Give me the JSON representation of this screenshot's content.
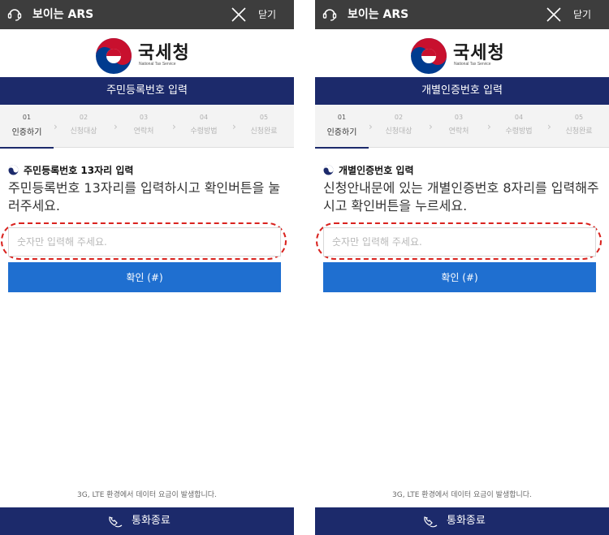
{
  "panels": [
    {
      "topbar": {
        "title": "보이는 ARS",
        "close_label": "닫기"
      },
      "logo": {
        "name": "국세청",
        "subtitle": "National Tax Service"
      },
      "page_title": "주민등록번호 입력",
      "steps": [
        {
          "num": "01",
          "label": "인증하기"
        },
        {
          "num": "02",
          "label": "신청대상"
        },
        {
          "num": "03",
          "label": "연락처"
        },
        {
          "num": "04",
          "label": "수령방법"
        },
        {
          "num": "05",
          "label": "신청완료"
        }
      ],
      "heading": "주민등록번호 13자리 입력",
      "instruction": "주민등록번호 13자리를 입력하시고 확인버튼을 눌러주세요.",
      "input_placeholder": "숫자만 입력해 주세요.",
      "confirm_label": "확인 (#)",
      "notice": "3G, LTE 환경에서 데이터 요금이 발생합니다.",
      "end_call_label": "통화종료"
    },
    {
      "topbar": {
        "title": "보이는 ARS",
        "close_label": "닫기"
      },
      "logo": {
        "name": "국세청",
        "subtitle": "National Tax Service"
      },
      "page_title": "개별인증번호 입력",
      "steps": [
        {
          "num": "01",
          "label": "인증하기"
        },
        {
          "num": "02",
          "label": "신청대상"
        },
        {
          "num": "03",
          "label": "연락처"
        },
        {
          "num": "04",
          "label": "수령방법"
        },
        {
          "num": "05",
          "label": "신청완료"
        }
      ],
      "heading": "개별인증번호 입력",
      "instruction": "신청안내문에 있는 개별인증번호 8자리를 입력해주시고 확인버튼을 누르세요.",
      "input_placeholder": "숫자만 입력해 주세요.",
      "confirm_label": "확인 (#)",
      "notice": "3G, LTE 환경에서 데이터 요금이 발생합니다.",
      "end_call_label": "통화종료"
    }
  ],
  "active_step_index": 0,
  "colors": {
    "topbar": "#3d3d3d",
    "navy": "#1c2a6b",
    "button_blue": "#1f6fd0",
    "highlight_red": "#d9231f",
    "emblem_red": "#c8102e",
    "emblem_blue": "#003b8f"
  },
  "icons": {
    "topbar_left": "headset-icon",
    "topbar_right": "close-icon",
    "logo": "government-emblem-icon",
    "heading": "bullet-emblem-icon",
    "bottom": "end-call-icon",
    "step_separator": "chevron-right-icon"
  }
}
